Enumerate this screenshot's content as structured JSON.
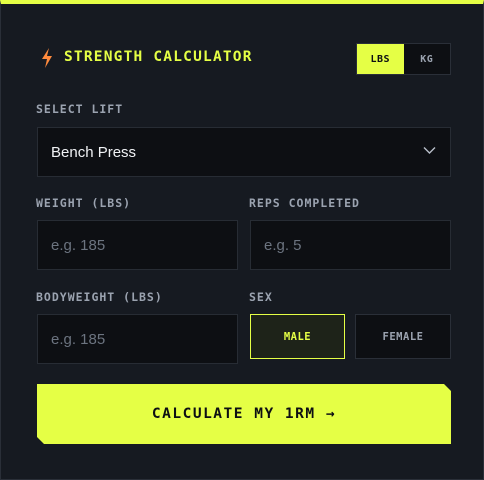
{
  "header": {
    "icon": "lightning-bolt-icon",
    "title": "STRENGTH CALCULATOR",
    "units": [
      {
        "label": "LBS",
        "active": true
      },
      {
        "label": "KG",
        "active": false
      }
    ]
  },
  "lift": {
    "label": "SELECT LIFT",
    "selected": "Bench Press"
  },
  "weight": {
    "label": "WEIGHT (LBS)",
    "placeholder": "e.g. 185"
  },
  "reps": {
    "label": "REPS COMPLETED",
    "placeholder": "e.g. 5"
  },
  "bodyweight": {
    "label": "BODYWEIGHT (LBS)",
    "placeholder": "e.g. 185"
  },
  "sex": {
    "label": "SEX",
    "options": [
      {
        "label": "MALE",
        "active": true
      },
      {
        "label": "FEMALE",
        "active": false
      }
    ]
  },
  "calculate": {
    "label": "CALCULATE MY 1RM →"
  },
  "colors": {
    "accent": "#e5ff45",
    "bolt": "#ff8a3d",
    "card": "#161a21",
    "field": "#0d0f13"
  }
}
